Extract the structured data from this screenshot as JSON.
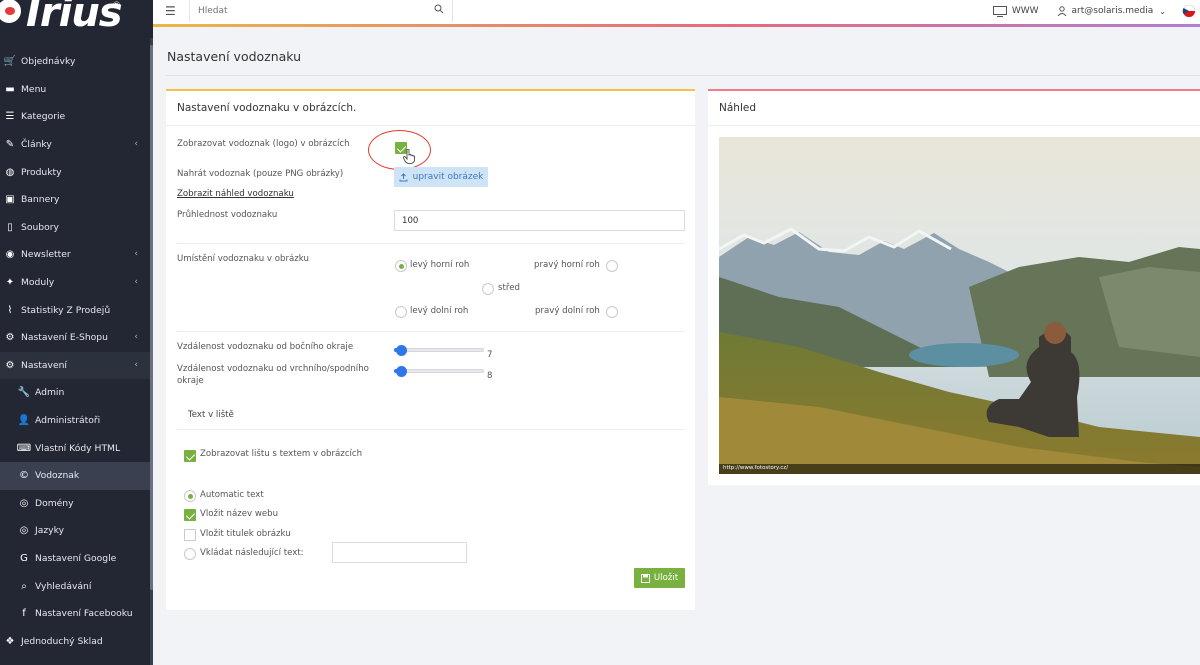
{
  "brand": {
    "logo_text": "Irius",
    "reg": "®"
  },
  "sidebar": {
    "items": [
      {
        "label": "Objednávky",
        "icon": "cart-icon",
        "glyph": "🛒"
      },
      {
        "label": "Menu",
        "icon": "folder-icon",
        "glyph": "▬"
      },
      {
        "label": "Kategorie",
        "icon": "list-icon",
        "glyph": "☰"
      },
      {
        "label": "Články",
        "icon": "pencil-icon",
        "glyph": "✎",
        "chevron": "‹"
      },
      {
        "label": "Produkty",
        "icon": "dribbble-icon",
        "glyph": "◍"
      },
      {
        "label": "Bannery",
        "icon": "image-icon",
        "glyph": "▣"
      },
      {
        "label": "Soubory",
        "icon": "file-icon",
        "glyph": "▯"
      },
      {
        "label": "Newsletter",
        "icon": "newsletter-icon",
        "glyph": "◉",
        "chevron": "‹"
      },
      {
        "label": "Moduly",
        "icon": "puzzle-icon",
        "glyph": "✦",
        "chevron": "‹"
      },
      {
        "label": "Statistiky Z Prodejů",
        "icon": "chart-icon",
        "glyph": "⌇"
      },
      {
        "label": "Nastavení E-Shopu",
        "icon": "gears-icon",
        "glyph": "⚙",
        "chevron": "‹"
      },
      {
        "label": "Nastavení",
        "icon": "gears-icon",
        "glyph": "⚙",
        "chevron": "‹",
        "open": true
      },
      {
        "label": "Admin",
        "icon": "wrench-icon",
        "glyph": "🔧",
        "sub": true
      },
      {
        "label": "Administrátoři",
        "icon": "users-icon",
        "glyph": "👤",
        "sub": true
      },
      {
        "label": "Vlastní Kódy HTML",
        "icon": "html-icon",
        "glyph": "⌨",
        "sub": true
      },
      {
        "label": "Vodoznak",
        "icon": "copyright-icon",
        "glyph": "©",
        "sub": true,
        "active": true
      },
      {
        "label": "Domény",
        "icon": "globe-icon",
        "glyph": "◎",
        "sub": true
      },
      {
        "label": "Jazyky",
        "icon": "globe-icon",
        "glyph": "◎",
        "sub": true
      },
      {
        "label": "Nastavení Google",
        "icon": "google-icon",
        "glyph": "G",
        "sub": true
      },
      {
        "label": "Vyhledávání",
        "icon": "search-icon",
        "glyph": "⌕",
        "sub": true
      },
      {
        "label": "Nastavení Facebooku",
        "icon": "facebook-icon",
        "glyph": "f",
        "sub": true
      },
      {
        "label": "Jednoduchý Sklad",
        "icon": "dropbox-icon",
        "glyph": "❖"
      }
    ]
  },
  "topbar": {
    "search_placeholder": "Hledat",
    "www_label": "WWW",
    "user_label": "art@solaris.media"
  },
  "page": {
    "title": "Nastavení vodoznaku"
  },
  "form": {
    "title": "Nastavení vodoznaku v obrázcích.",
    "show_watermark_label": "Zobrazovat vodoznak (logo) v obrázcích",
    "show_watermark_checked": true,
    "upload_label": "Nahrát vodoznak (pouze PNG obrázky)",
    "upload_button": "upravit obrázek",
    "preview_link": "Zobrazit náhled vodoznaku",
    "opacity_label": "Průhlednost vodoznaku",
    "opacity_value": "100",
    "position_label": "Umístění vodoznaku v obrázku",
    "positions": {
      "top_left": "levý horní roh",
      "top_right": "pravý horní roh",
      "center": "střed",
      "bottom_left": "levý dolní roh",
      "bottom_right": "pravý dolní roh",
      "selected": "top_left"
    },
    "side_distance_label": "Vzdálenost vodoznaku od bočního okraje",
    "side_distance_value": "7",
    "top_distance_label": "Vzdálenost vodoznaku od vrchního/spodního okraje",
    "top_distance_value": "8",
    "text_bar_tab": "Text v liště",
    "show_bar_label": "Zobrazovat lištu s textem v obrázcích",
    "automatic_text_label": "Automatic text",
    "insert_site_name_label": "Vložit název webu",
    "insert_image_title_label": "Vložit titulek obrázku",
    "insert_custom_text_label": "Vkládat následující text:",
    "custom_text_value": "",
    "save_button": "Uložit"
  },
  "preview": {
    "title": "Náhled",
    "watermark_text": "http://www.fotostory.cz/"
  },
  "colors": {
    "sidebar_bg": "#232733",
    "accent_green": "#78b13f",
    "slider_blue": "#2f77e8",
    "left_card_accent": "#f2c14e",
    "right_card_accent": "#ef7e8c",
    "highlight_red": "#e03c31"
  }
}
